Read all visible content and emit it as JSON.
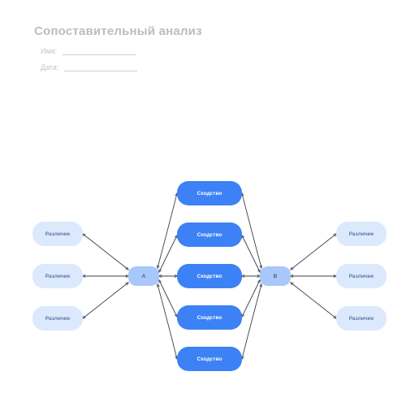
{
  "title": "Сопоставительный анализ",
  "meta": {
    "name_label": "Имя:",
    "date_label": "Дата:"
  },
  "nodes": {
    "hub_a": "A",
    "hub_b": "B",
    "diff_a": [
      "Различие",
      "Различие",
      "Различие"
    ],
    "diff_b": [
      "Различие",
      "Различие",
      "Различие"
    ],
    "sim": [
      "Сходство",
      "Сходство",
      "Сходство",
      "Сходство",
      "Сходство"
    ]
  },
  "colors": {
    "difference_fill": "#dce9fd",
    "similarity_fill": "#3c82f6",
    "hub_fill": "#a8c7fa",
    "title_color": "#b9bdc4",
    "connector": "#3a3f47"
  },
  "chart_data": {
    "type": "diagram",
    "diagram_kind": "double-bubble-comparison",
    "entities": [
      "A",
      "B"
    ],
    "similarities_count": 5,
    "differences_per_entity": 3,
    "edges": [
      {
        "from": "A",
        "to": "diff_a[0]",
        "bidirectional": true
      },
      {
        "from": "A",
        "to": "diff_a[1]",
        "bidirectional": true
      },
      {
        "from": "A",
        "to": "diff_a[2]",
        "bidirectional": true
      },
      {
        "from": "A",
        "to": "sim[0]",
        "bidirectional": true
      },
      {
        "from": "A",
        "to": "sim[1]",
        "bidirectional": true
      },
      {
        "from": "A",
        "to": "sim[2]",
        "bidirectional": true
      },
      {
        "from": "A",
        "to": "sim[3]",
        "bidirectional": true
      },
      {
        "from": "A",
        "to": "sim[4]",
        "bidirectional": true
      },
      {
        "from": "B",
        "to": "sim[0]",
        "bidirectional": true
      },
      {
        "from": "B",
        "to": "sim[1]",
        "bidirectional": true
      },
      {
        "from": "B",
        "to": "sim[2]",
        "bidirectional": true
      },
      {
        "from": "B",
        "to": "sim[3]",
        "bidirectional": true
      },
      {
        "from": "B",
        "to": "sim[4]",
        "bidirectional": true
      },
      {
        "from": "B",
        "to": "diff_b[0]",
        "bidirectional": true
      },
      {
        "from": "B",
        "to": "diff_b[1]",
        "bidirectional": true
      },
      {
        "from": "B",
        "to": "diff_b[2]",
        "bidirectional": true
      }
    ]
  }
}
